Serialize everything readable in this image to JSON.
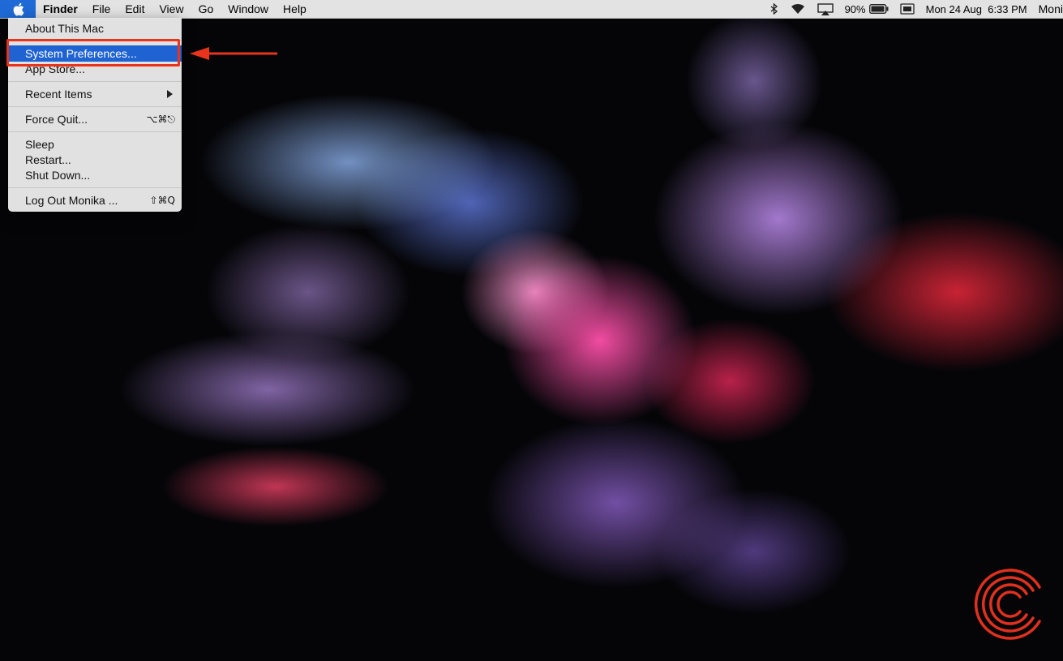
{
  "menubar": {
    "apple_menu_icon": "apple-icon",
    "app_name": "Finder",
    "menus": [
      "File",
      "Edit",
      "View",
      "Go",
      "Window",
      "Help"
    ],
    "status": {
      "icons": [
        "bluetooth-icon",
        "wifi-icon",
        "airplay-icon",
        "battery-icon",
        "input-source-icon"
      ],
      "battery_percent": "90%",
      "datetime": "Mon 24 Aug  6:33 PM",
      "user": "Moni"
    },
    "highlight_color": "#1f6ad6"
  },
  "apple_menu": {
    "items": [
      {
        "label": "About This Mac",
        "shortcut": ""
      },
      {
        "label": "System Preferences...",
        "shortcut": ""
      },
      {
        "label": "App Store...",
        "shortcut": ""
      },
      {
        "label": "Recent Items",
        "shortcut": ""
      },
      {
        "label": "Force Quit...",
        "shortcut": "⌥⌘⎋"
      },
      {
        "label": "Sleep",
        "shortcut": ""
      },
      {
        "label": "Restart...",
        "shortcut": ""
      },
      {
        "label": "Shut Down...",
        "shortcut": ""
      },
      {
        "label": "Log Out Monika ...",
        "shortcut": "⇧⌘Q"
      }
    ],
    "selected_item": "System Preferences..."
  },
  "annotation": {
    "color": "#e8341c",
    "arrow_icon": "arrow-left-icon"
  },
  "watermark_icon": "brand-logo-icon"
}
